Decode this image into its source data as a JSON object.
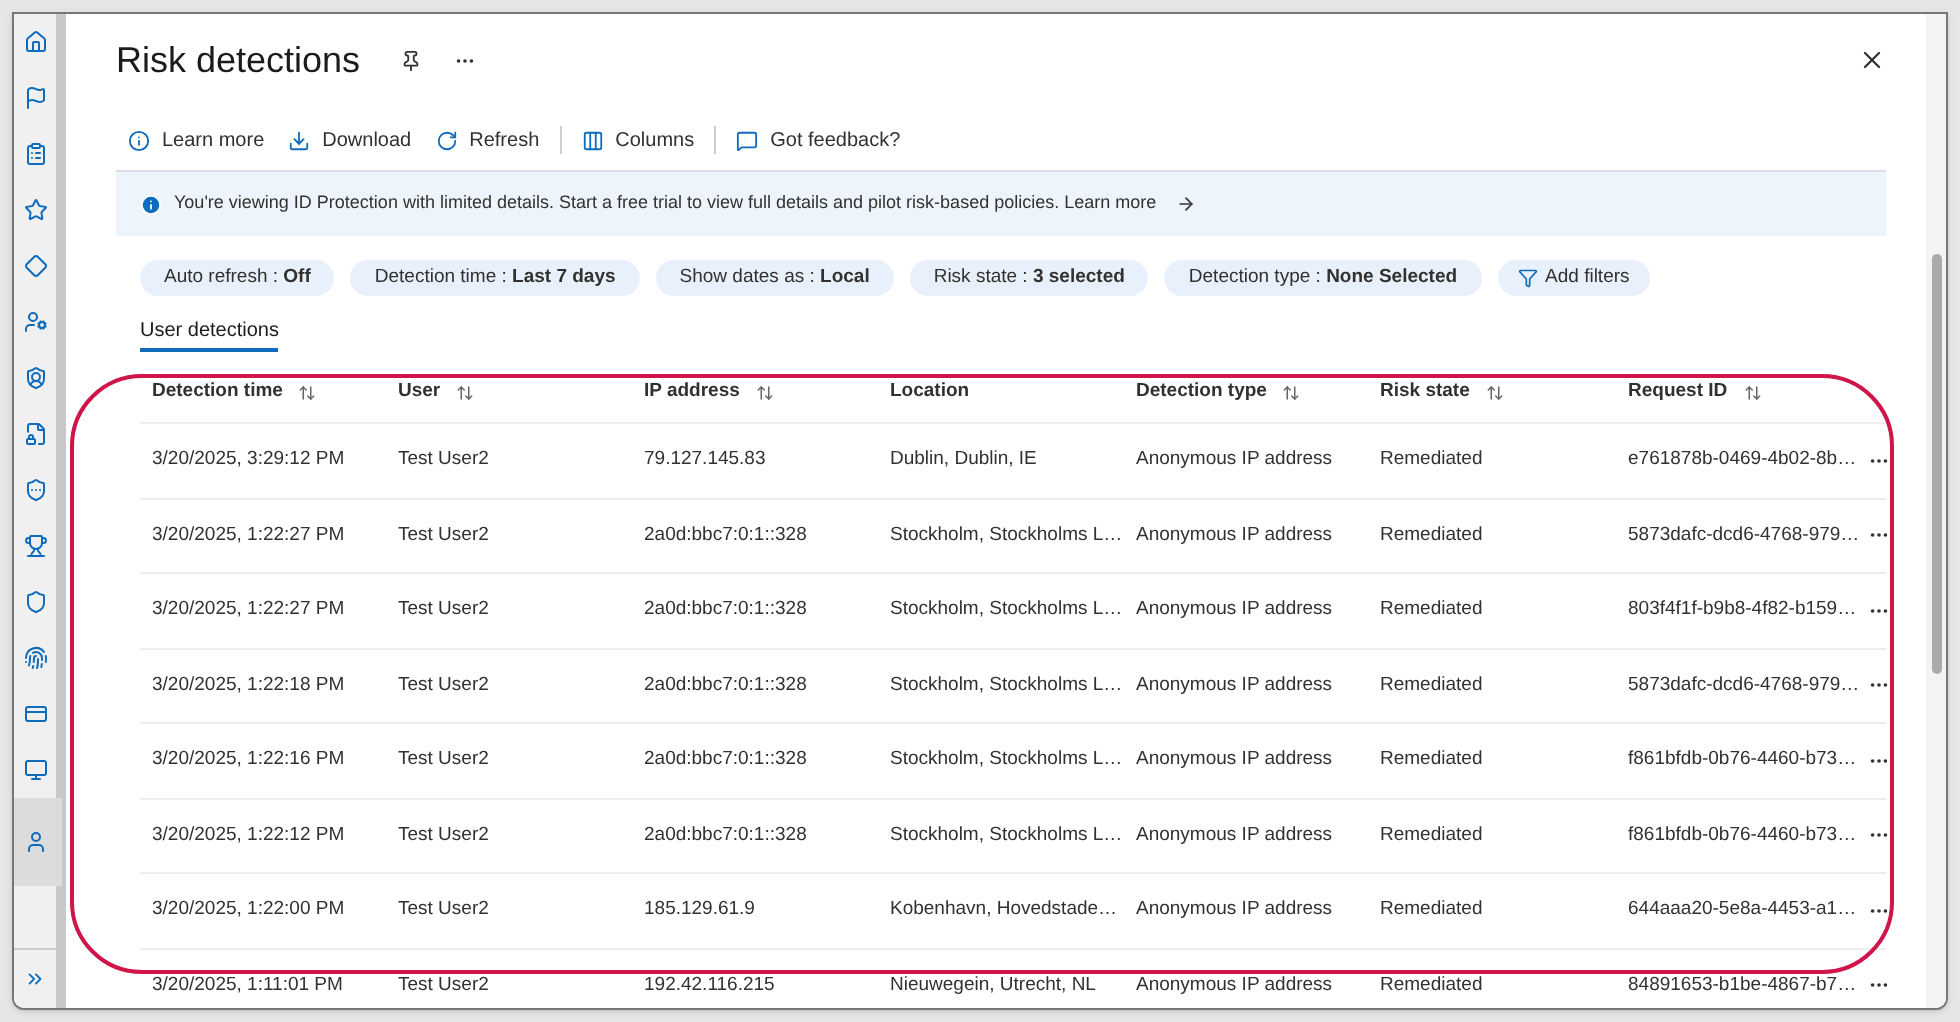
{
  "sidebar": {
    "items": [
      {
        "selected": false
      },
      {
        "selected": false
      },
      {
        "selected": false
      },
      {
        "selected": false
      },
      {
        "selected": false
      },
      {
        "selected": false
      },
      {
        "selected": false
      },
      {
        "selected": false
      },
      {
        "selected": false
      },
      {
        "selected": false
      },
      {
        "selected": false
      },
      {
        "selected": false
      },
      {
        "selected": false
      },
      {
        "selected": false
      },
      {
        "selected": true
      }
    ]
  },
  "title": "Risk detections",
  "toolbar": [
    "Learn more",
    "Download",
    "Refresh",
    "Columns",
    "Got feedback?"
  ],
  "banner": {
    "text": "You're viewing ID Protection with limited details. Start a free trial to view full details and pilot risk-based policies. Learn more"
  },
  "filters": [
    {
      "label": "Auto refresh : ",
      "value": "Off"
    },
    {
      "label": "Detection time : ",
      "value": "Last 7 days"
    },
    {
      "label": "Show dates as : ",
      "value": "Local"
    },
    {
      "label": "Risk state : ",
      "value": "3 selected"
    },
    {
      "label": "Detection type : ",
      "value": "None Selected"
    }
  ],
  "add_filter": "Add filters",
  "tabs": [
    {
      "label": "User detections",
      "selected": true
    }
  ],
  "table": {
    "columns": [
      {
        "label": "Detection time",
        "sortable": true
      },
      {
        "label": "User",
        "sortable": true
      },
      {
        "label": "IP address",
        "sortable": true
      },
      {
        "label": "Location",
        "sortable": false
      },
      {
        "label": "Detection type",
        "sortable": true
      },
      {
        "label": "Risk state",
        "sortable": true
      },
      {
        "label": "Request ID",
        "sortable": true
      }
    ],
    "rows": [
      [
        "3/20/2025, 3:29:12 PM",
        "Test User2",
        "79.127.145.83",
        "Dublin, Dublin, IE",
        "Anonymous IP address",
        "Remediated",
        "e761878b-0469-4b02-8b…"
      ],
      [
        "3/20/2025, 1:22:27 PM",
        "Test User2",
        "2a0d:bbc7:0:1::328",
        "Stockholm, Stockholms L…",
        "Anonymous IP address",
        "Remediated",
        "5873dafc-dcd6-4768-979…"
      ],
      [
        "3/20/2025, 1:22:27 PM",
        "Test User2",
        "2a0d:bbc7:0:1::328",
        "Stockholm, Stockholms L…",
        "Anonymous IP address",
        "Remediated",
        "803f4f1f-b9b8-4f82-b159…"
      ],
      [
        "3/20/2025, 1:22:18 PM",
        "Test User2",
        "2a0d:bbc7:0:1::328",
        "Stockholm, Stockholms L…",
        "Anonymous IP address",
        "Remediated",
        "5873dafc-dcd6-4768-979…"
      ],
      [
        "3/20/2025, 1:22:16 PM",
        "Test User2",
        "2a0d:bbc7:0:1::328",
        "Stockholm, Stockholms L…",
        "Anonymous IP address",
        "Remediated",
        "f861bfdb-0b76-4460-b73…"
      ],
      [
        "3/20/2025, 1:22:12 PM",
        "Test User2",
        "2a0d:bbc7:0:1::328",
        "Stockholm, Stockholms L…",
        "Anonymous IP address",
        "Remediated",
        "f861bfdb-0b76-4460-b73…"
      ],
      [
        "3/20/2025, 1:22:00 PM",
        "Test User2",
        "185.129.61.9",
        "Kobenhavn, Hovedstade…",
        "Anonymous IP address",
        "Remediated",
        "644aaa20-5e8a-4453-a1…"
      ],
      [
        "3/20/2025, 1:11:01 PM",
        "Test User2",
        "192.42.116.215",
        "Nieuwegein, Utrecht, NL",
        "Anonymous IP address",
        "Remediated",
        "84891653-b1be-4867-b7…"
      ]
    ]
  }
}
